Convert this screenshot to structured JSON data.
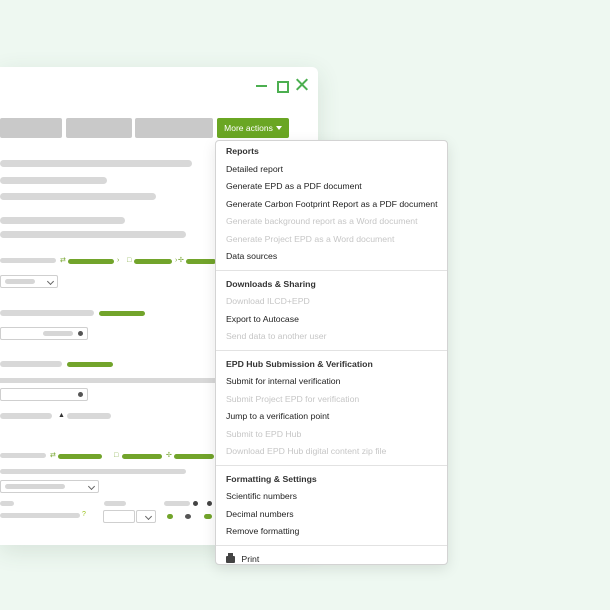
{
  "toolbar": {
    "more_actions_label": "More actions"
  },
  "menu": {
    "sections": [
      {
        "title": "Reports",
        "items": [
          {
            "label": "Detailed report",
            "enabled": true
          },
          {
            "label": "Generate EPD as a PDF document",
            "enabled": true
          },
          {
            "label": "Generate Carbon Footprint Report as a PDF document",
            "enabled": true
          },
          {
            "label": "Generate background report as a Word document",
            "enabled": false
          },
          {
            "label": "Generate Project EPD as a Word document",
            "enabled": false
          },
          {
            "label": "Data sources",
            "enabled": true
          }
        ]
      },
      {
        "title": "Downloads & Sharing",
        "items": [
          {
            "label": "Download ILCD+EPD",
            "enabled": false
          },
          {
            "label": "Export to Autocase",
            "enabled": true
          },
          {
            "label": "Send data to another user",
            "enabled": false
          }
        ]
      },
      {
        "title": "EPD Hub Submission & Verification",
        "items": [
          {
            "label": "Submit for internal verification",
            "enabled": true
          },
          {
            "label": "Submit Project EPD for verification",
            "enabled": false
          },
          {
            "label": "Jump to a verification point",
            "enabled": true
          },
          {
            "label": "Submit to EPD Hub",
            "enabled": false
          },
          {
            "label": "Download EPD Hub digital content zip file",
            "enabled": false
          }
        ]
      },
      {
        "title": "Formatting & Settings",
        "items": [
          {
            "label": "Scientific numbers",
            "enabled": true
          },
          {
            "label": "Decimal numbers",
            "enabled": true
          },
          {
            "label": "Remove formatting",
            "enabled": true
          }
        ]
      }
    ],
    "print_label": "Print",
    "print_icon": "printer-icon"
  },
  "colors": {
    "accent": "#6aa623",
    "disabled_text": "#c6c6c6"
  }
}
